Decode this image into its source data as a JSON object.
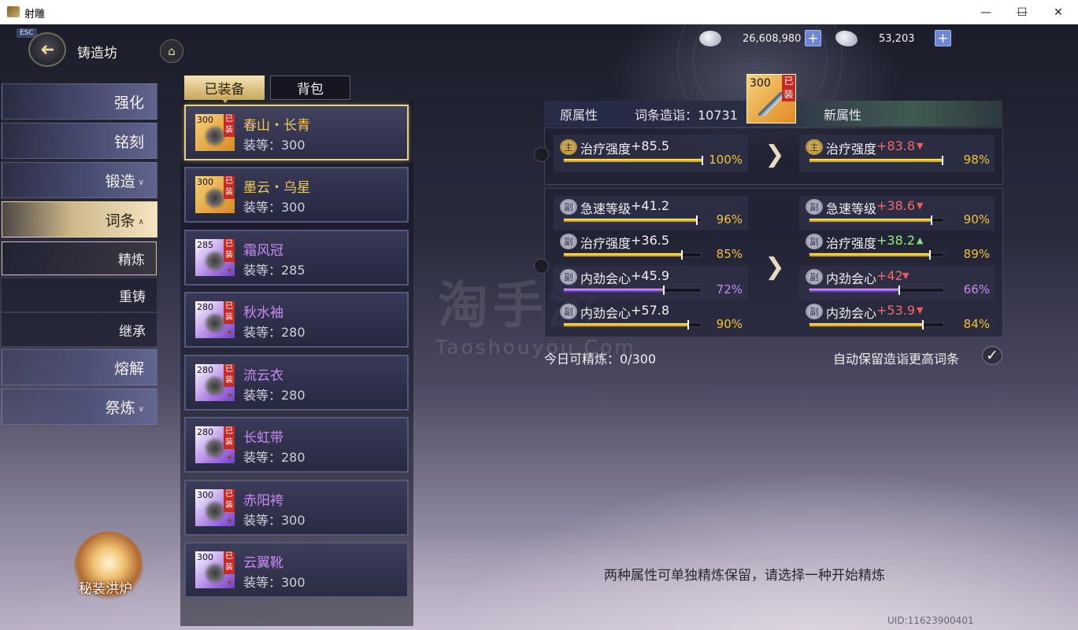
{
  "window": {
    "title": "射雕",
    "minimize": "—",
    "maximize": "☐",
    "close": "✕"
  },
  "header": {
    "esc": "ESC",
    "back_glyph": "➜",
    "title": "铸造坊",
    "home_glyph": "⌂"
  },
  "currency": [
    {
      "icon": "silver-coin-icon",
      "value": "26,608,980",
      "plus": "+"
    },
    {
      "icon": "silver-ingot-icon",
      "value": "53,203",
      "plus": "+"
    }
  ],
  "sidebar": {
    "items": [
      {
        "label": "强化",
        "chev": ""
      },
      {
        "label": "铭刻",
        "chev": ""
      },
      {
        "label": "锻造",
        "chev": "∨"
      },
      {
        "label": "词条",
        "chev": "∧",
        "active": true
      },
      {
        "label": "熔解",
        "chev": ""
      },
      {
        "label": "祭炼",
        "chev": "∨"
      }
    ],
    "sub": [
      {
        "label": "精炼",
        "active": true
      },
      {
        "label": "重铸"
      },
      {
        "label": "继承"
      }
    ],
    "furnace_label": "秘装洪炉"
  },
  "tabs": {
    "equipped": "已装备",
    "bag": "背包"
  },
  "items": [
    {
      "lvl": "300",
      "tag": "已装",
      "name": "春山・长青",
      "level": "装等：300",
      "quality": "gold",
      "selected": true
    },
    {
      "lvl": "300",
      "tag": "已装",
      "name": "墨云・乌星",
      "level": "装等：300",
      "quality": "gold"
    },
    {
      "lvl": "285",
      "tag": "已装",
      "name": "霜风冠",
      "level": "装等：285",
      "quality": "purple"
    },
    {
      "lvl": "280",
      "tag": "已装",
      "name": "秋水袖",
      "level": "装等：280",
      "quality": "purple"
    },
    {
      "lvl": "280",
      "tag": "已装",
      "name": "流云衣",
      "level": "装等：280",
      "quality": "purple"
    },
    {
      "lvl": "280",
      "tag": "已装",
      "name": "长虹带",
      "level": "装等：280",
      "quality": "purple"
    },
    {
      "lvl": "300",
      "tag": "已装",
      "name": "赤阳袴",
      "level": "装等：300",
      "quality": "purple"
    },
    {
      "lvl": "300",
      "tag": "已装",
      "name": "云翼靴",
      "level": "装等：300",
      "quality": "purple"
    }
  ],
  "refine": {
    "orig_label": "原属性",
    "score_label": "词条造诣：10731",
    "new_label": "新属性",
    "icon": {
      "lvl": "300",
      "tag": "已装"
    },
    "main_badge": "主",
    "sub_badge": "副",
    "main_orig": {
      "name": "治疗强度",
      "value": "+85.5",
      "pct": "100%",
      "fill": 1.0,
      "color": "gold"
    },
    "main_new": {
      "name": "治疗强度",
      "value": "+83.8",
      "trend": "▼",
      "dir": "down",
      "pct": "98%",
      "fill": 0.98,
      "color": "gold"
    },
    "sub_orig": [
      {
        "name": "急速等级",
        "value": "+41.2",
        "pct": "96%",
        "fill": 0.96,
        "color": "gold"
      },
      {
        "name": "治疗强度",
        "value": "+36.5",
        "pct": "85%",
        "fill": 0.85,
        "color": "gold"
      },
      {
        "name": "内劲会心",
        "value": "+45.9",
        "pct": "72%",
        "fill": 0.72,
        "color": "purple"
      },
      {
        "name": "内劲会心",
        "value": "+57.8",
        "pct": "90%",
        "fill": 0.9,
        "color": "gold"
      }
    ],
    "sub_new": [
      {
        "name": "急速等级",
        "value": "+38.6",
        "trend": "▼",
        "dir": "down",
        "pct": "90%",
        "fill": 0.9,
        "color": "gold"
      },
      {
        "name": "治疗强度",
        "value": "+38.2",
        "trend": "▲",
        "dir": "up",
        "pct": "89%",
        "fill": 0.89,
        "color": "gold"
      },
      {
        "name": "内劲会心",
        "value": "+42",
        "trend": "▼",
        "dir": "down",
        "pct": "66%",
        "fill": 0.66,
        "color": "purple"
      },
      {
        "name": "内劲会心",
        "value": "+53.9",
        "trend": "▼",
        "dir": "down",
        "pct": "84%",
        "fill": 0.84,
        "color": "gold"
      }
    ],
    "arrow_glyph": "❯",
    "daily": "今日可精炼：0/300",
    "auto_keep": "自动保留造诣更高词条",
    "check_glyph": "✓"
  },
  "hint": "两种属性可单独精炼保留，请选择一种开始精炼",
  "uid": "UID:11623900401",
  "watermark": {
    "cn": "淘手游",
    "en": "Taoshouyou.Com"
  }
}
